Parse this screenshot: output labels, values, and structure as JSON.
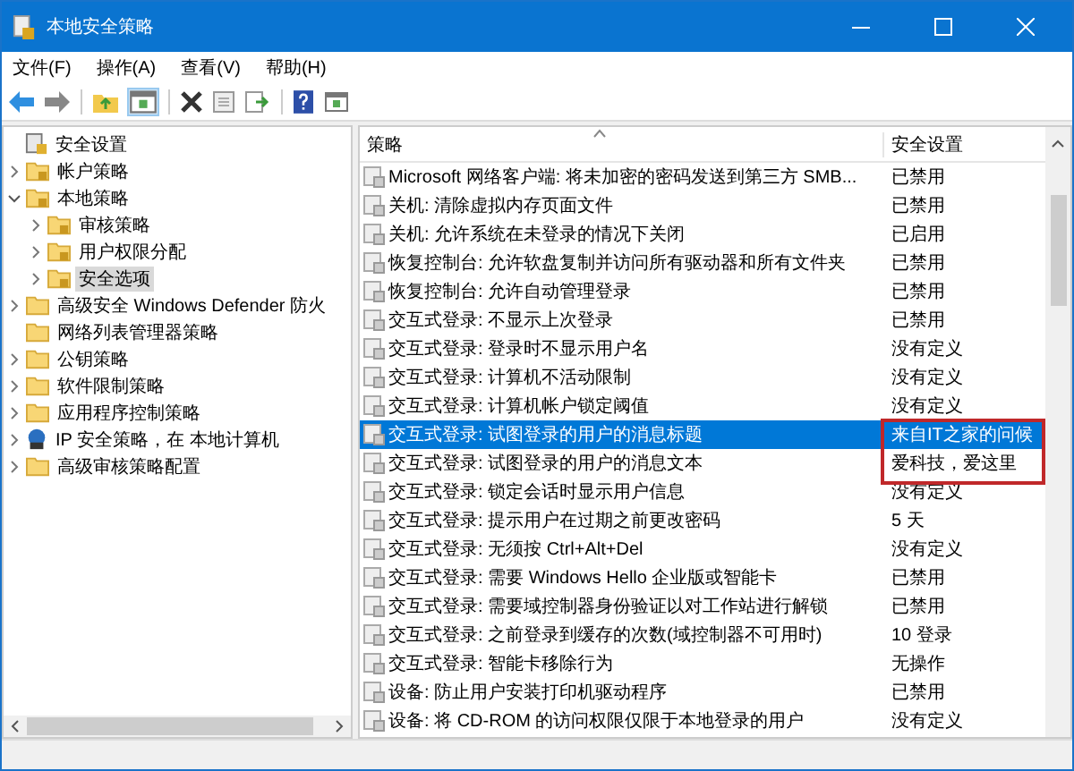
{
  "window": {
    "title": "本地安全策略"
  },
  "menu": [
    "文件(F)",
    "操作(A)",
    "查看(V)",
    "帮助(H)"
  ],
  "tree": [
    {
      "label": "安全设置",
      "kind": "root",
      "selected": false,
      "children": [
        {
          "label": "帐户策略",
          "kind": "locked-folder",
          "expanded": false,
          "selected": false
        },
        {
          "label": "本地策略",
          "kind": "locked-folder",
          "expanded": true,
          "selected": false,
          "children": [
            {
              "label": "审核策略",
              "kind": "locked-folder",
              "expanded": false,
              "selected": false
            },
            {
              "label": "用户权限分配",
              "kind": "locked-folder",
              "expanded": false,
              "selected": false
            },
            {
              "label": "安全选项",
              "kind": "locked-folder",
              "expanded": false,
              "selected": true
            }
          ]
        },
        {
          "label": "高级安全 Windows Defender 防火",
          "kind": "folder",
          "expanded": false,
          "selected": false
        },
        {
          "label": "网络列表管理器策略",
          "kind": "leaf-folder",
          "selected": false
        },
        {
          "label": "公钥策略",
          "kind": "folder",
          "expanded": false,
          "selected": false
        },
        {
          "label": "软件限制策略",
          "kind": "folder",
          "expanded": false,
          "selected": false
        },
        {
          "label": "应用程序控制策略",
          "kind": "folder",
          "expanded": false,
          "selected": false
        },
        {
          "label": "IP 安全策略，在 本地计算机",
          "kind": "network",
          "expanded": false,
          "selected": false
        },
        {
          "label": "高级审核策略配置",
          "kind": "folder",
          "expanded": false,
          "selected": false
        }
      ]
    }
  ],
  "table": {
    "columns": [
      "策略",
      "安全设置"
    ],
    "rows": [
      {
        "policy": "Microsoft 网络客户端: 将未加密的密码发送到第三方 SMB...",
        "setting": "已禁用",
        "selected": false
      },
      {
        "policy": "关机: 清除虚拟内存页面文件",
        "setting": "已禁用",
        "selected": false
      },
      {
        "policy": "关机: 允许系统在未登录的情况下关闭",
        "setting": "已启用",
        "selected": false
      },
      {
        "policy": "恢复控制台: 允许软盘复制并访问所有驱动器和所有文件夹",
        "setting": "已禁用",
        "selected": false
      },
      {
        "policy": "恢复控制台: 允许自动管理登录",
        "setting": "已禁用",
        "selected": false
      },
      {
        "policy": "交互式登录: 不显示上次登录",
        "setting": "已禁用",
        "selected": false
      },
      {
        "policy": "交互式登录: 登录时不显示用户名",
        "setting": "没有定义",
        "selected": false
      },
      {
        "policy": "交互式登录: 计算机不活动限制",
        "setting": "没有定义",
        "selected": false
      },
      {
        "policy": "交互式登录: 计算机帐户锁定阈值",
        "setting": "没有定义",
        "selected": false
      },
      {
        "policy": "交互式登录: 试图登录的用户的消息标题",
        "setting": "来自IT之家的问候",
        "selected": true
      },
      {
        "policy": "交互式登录: 试图登录的用户的消息文本",
        "setting": "爱科技，爱这里",
        "selected": false
      },
      {
        "policy": "交互式登录: 锁定会话时显示用户信息",
        "setting": "没有定义",
        "selected": false
      },
      {
        "policy": "交互式登录: 提示用户在过期之前更改密码",
        "setting": "5 天",
        "selected": false
      },
      {
        "policy": "交互式登录: 无须按 Ctrl+Alt+Del",
        "setting": "没有定义",
        "selected": false
      },
      {
        "policy": "交互式登录: 需要 Windows Hello 企业版或智能卡",
        "setting": "已禁用",
        "selected": false
      },
      {
        "policy": "交互式登录: 需要域控制器身份验证以对工作站进行解锁",
        "setting": "已禁用",
        "selected": false
      },
      {
        "policy": "交互式登录: 之前登录到缓存的次数(域控制器不可用时)",
        "setting": "10 登录",
        "selected": false
      },
      {
        "policy": "交互式登录: 智能卡移除行为",
        "setting": "无操作",
        "selected": false
      },
      {
        "policy": "设备: 防止用户安装打印机驱动程序",
        "setting": "已禁用",
        "selected": false
      },
      {
        "policy": "设备: 将 CD-ROM 的访问权限仅限于本地登录的用户",
        "setting": "没有定义",
        "selected": false
      }
    ]
  }
}
